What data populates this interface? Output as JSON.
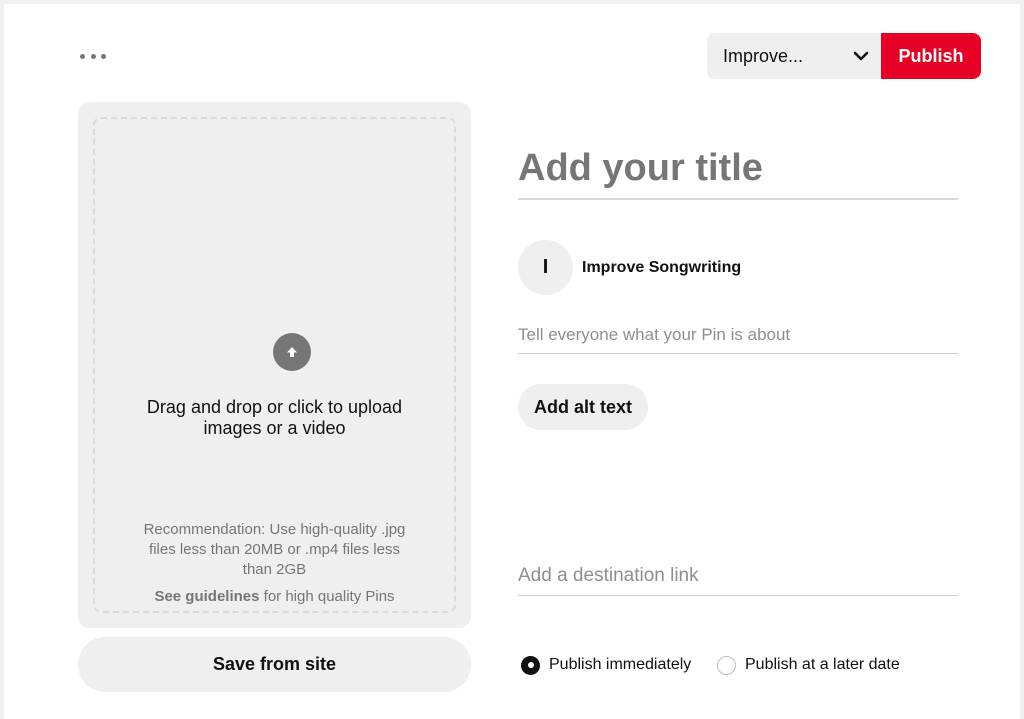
{
  "toolbar": {
    "more_icon": "more-horizontal-icon",
    "board_select_value": "Improve...",
    "chevron_icon": "chevron-down-icon",
    "publish_label": "Publish",
    "publish_color": "#e60023"
  },
  "upload": {
    "icon": "upload-arrow-icon",
    "instruction": "Drag and drop or click to upload images or a video",
    "recommendation": "Recommendation: Use high-quality .jpg files less than 20MB or .mp4 files less than 2GB",
    "guidelines_link": "See guidelines",
    "guidelines_suffix": " for high quality Pins",
    "save_from_site_label": "Save from site"
  },
  "form": {
    "title_placeholder": "Add your title",
    "board_initial": "I",
    "board_name": "Improve Songwriting",
    "description_placeholder": "Tell everyone what your Pin is about",
    "alt_text_label": "Add alt text",
    "link_placeholder": "Add a destination link"
  },
  "schedule": {
    "selected": "Publish immediately",
    "options": [
      "Publish immediately",
      "Publish at a later date"
    ]
  }
}
